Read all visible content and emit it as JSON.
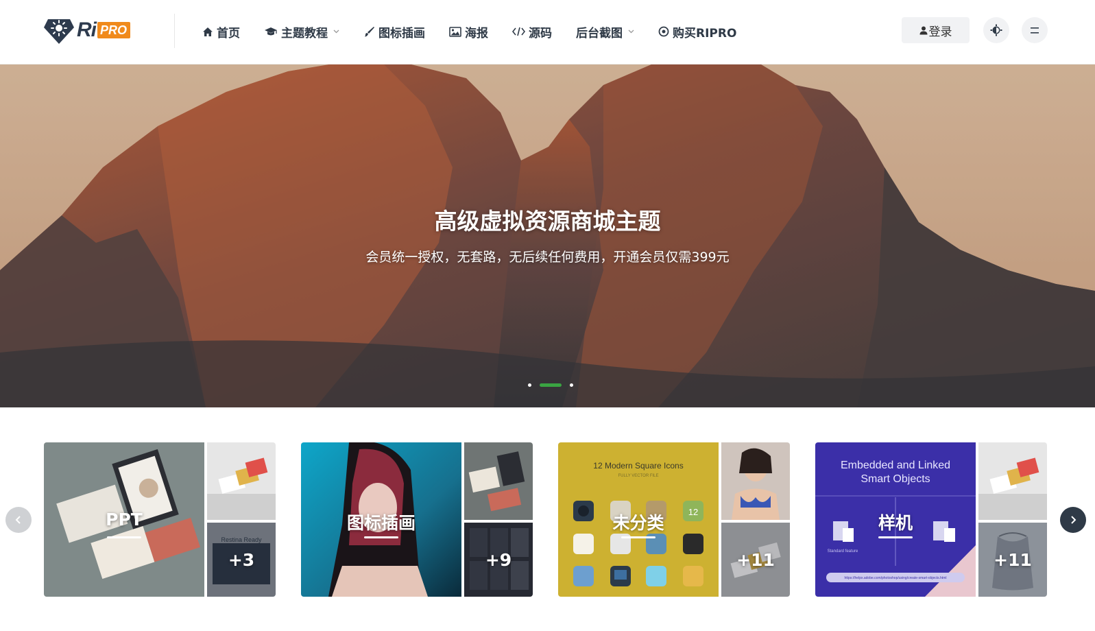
{
  "brand": {
    "ri": "Ri",
    "pro": "PRO",
    "accent": "#f08a1c",
    "dark": "#2e3b4e"
  },
  "nav": {
    "items": [
      {
        "label": "首页",
        "icon": "home-icon"
      },
      {
        "label": "主题教程",
        "icon": "graduation-cap-icon",
        "dropdown": true
      },
      {
        "label": "图标插画",
        "icon": "paint-brush-icon"
      },
      {
        "label": "海报",
        "icon": "image-icon"
      },
      {
        "label": "源码",
        "icon": "code-icon"
      },
      {
        "label": "后台截图",
        "icon": "none",
        "dropdown": true
      },
      {
        "label": "购买RIPRO",
        "icon": "target-icon"
      }
    ],
    "login_label": "登录"
  },
  "hero": {
    "title": "高级虚拟资源商城主题",
    "subtitle": "会员统一授权，无套路，无后续任何费用，开通会员仅需399元",
    "active_slide": 1,
    "slide_count": 3,
    "accent": "#3aa442"
  },
  "categories": [
    {
      "label": "PPT",
      "more": "+3",
      "thumb_text": "Restina Ready"
    },
    {
      "label": "图标插画",
      "more": "+9"
    },
    {
      "label": "未分类",
      "more": "+11",
      "thumb_title": "12 Modern Square Icons",
      "thumb_sub": "FULLY VECTOR FILE",
      "icon_number": "12"
    },
    {
      "label": "样机",
      "more": "+11",
      "thumb_title_1": "Embedded and Linked",
      "thumb_title_2": "Smart Objects",
      "thumb_caption": "Standard feature",
      "thumb_url": "https://helpx.adobe.com/photoshop/using/create-smart-objects.html"
    }
  ]
}
